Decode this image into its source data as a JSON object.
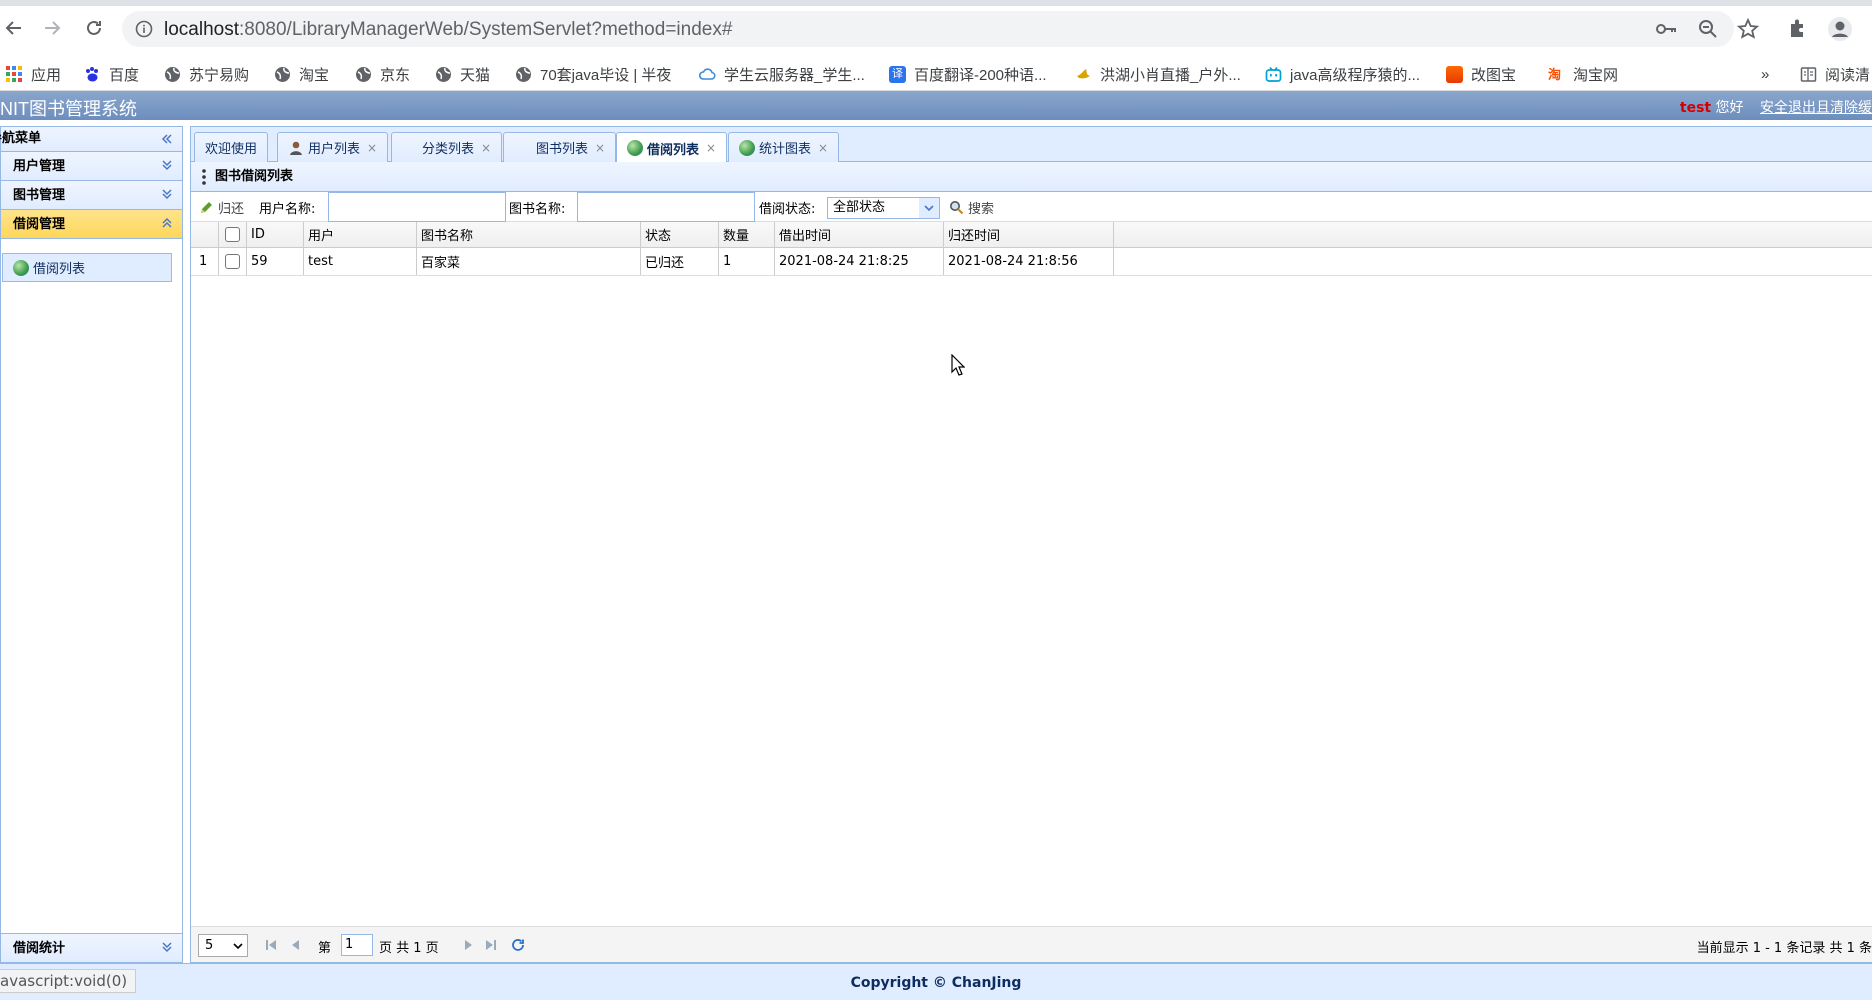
{
  "browser": {
    "url_host": "localhost",
    "url_path": ":8080/LibraryManagerWeb/SystemServlet?method=index#",
    "bookmarks": [
      "应用",
      "百度",
      "苏宁易购",
      "淘宝",
      "京东",
      "天猫",
      "70套java毕设 | 半夜",
      "学生云服务器_学生...",
      "百度翻译-200种语...",
      "洪湖小肖直播_户外...",
      "java高级程序猿的...",
      "改图宝",
      "淘宝网"
    ],
    "more_label": "»",
    "reading_list": "阅读清",
    "status_text": "avascript:void(0)"
  },
  "header": {
    "title": "NIT图书管理系统",
    "username": "test",
    "greeting": "您好",
    "logout": "安全退出且清除缓"
  },
  "nav": {
    "title": "导航菜单",
    "panels": [
      "用户管理",
      "图书管理",
      "借阅管理"
    ],
    "borrow_list": "借阅列表",
    "stats": "借阅统计"
  },
  "tabs": [
    {
      "label": "欢迎使用",
      "closable": false,
      "icon": "none"
    },
    {
      "label": "用户列表",
      "closable": true,
      "icon": "user-icon"
    },
    {
      "label": "分类列表",
      "closable": true,
      "icon": "none"
    },
    {
      "label": "图书列表",
      "closable": true,
      "icon": "none"
    },
    {
      "label": "借阅列表",
      "closable": true,
      "icon": "globe-icon",
      "selected": true
    },
    {
      "label": "统计图表",
      "closable": true,
      "icon": "globe-icon"
    }
  ],
  "panel": {
    "title": "图书借阅列表",
    "return_button": "归还",
    "user_name_label": "用户名称:",
    "book_name_label": "图书名称:",
    "status_label": "借阅状态:",
    "status_value": "全部状态",
    "search_button": "搜索"
  },
  "grid": {
    "columns": [
      "ID",
      "用户",
      "图书名称",
      "状态",
      "数量",
      "借出时间",
      "归还时间"
    ],
    "rows": [
      {
        "num": "1",
        "id": "59",
        "user": "test",
        "book": "百家菜",
        "status": "已归还",
        "qty": "1",
        "borrow_time": "2021-08-24 21:8:25",
        "return_time": "2021-08-24 21:8:56"
      }
    ]
  },
  "pager": {
    "page_size": "5",
    "page_prefix": "第",
    "page_value": "1",
    "page_suffix": "页 共 1 页",
    "summary": "当前显示 1 - 1 条记录 共 1 条"
  },
  "footer": {
    "copyright": "Copyright © ChanJing"
  },
  "colors": {
    "header_blue": "#7596c6",
    "panel_border": "#95b8e7",
    "active_panel": "#ffd65a",
    "username_red": "#d40000"
  }
}
